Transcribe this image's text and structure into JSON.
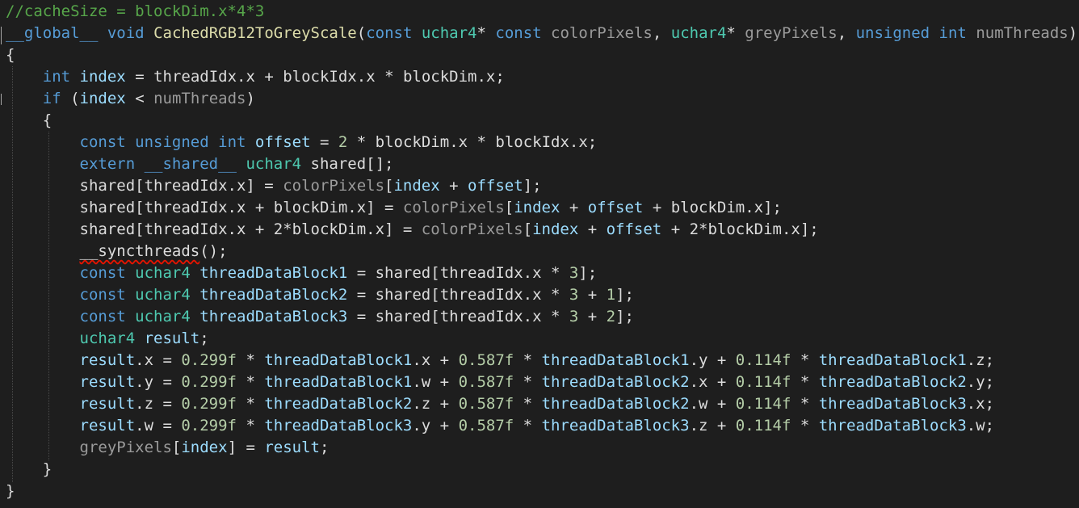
{
  "code": {
    "l1": {
      "t0": "//cacheSize = blockDim.x*4*3"
    },
    "l2": {
      "t0": "__global__",
      "t1": " ",
      "t2": "void",
      "t3": " ",
      "t4": "CachedRGB12ToGreyScale",
      "t5": "(",
      "t6": "const",
      "t7": " ",
      "t8": "uchar4",
      "t9": "* ",
      "t10": "const",
      "t11": " ",
      "t12": "colorPixels",
      "t13": ", ",
      "t14": "uchar4",
      "t15": "* ",
      "t16": "greyPixels",
      "t17": ", ",
      "t18": "unsigned",
      "t19": " ",
      "t20": "int",
      "t21": " ",
      "t22": "numThreads",
      "t23": ")"
    },
    "l3": {
      "t0": "{"
    },
    "l4": {
      "t0": "    ",
      "t1": "int",
      "t2": " ",
      "t3": "index",
      "t4": " = ",
      "t5": "threadIdx",
      "t6": ".x + ",
      "t7": "blockIdx",
      "t8": ".x * ",
      "t9": "blockDim",
      "t10": ".x;"
    },
    "l5": {
      "t0": "    ",
      "t1": "if",
      "t2": " (",
      "t3": "index",
      "t4": " < ",
      "t5": "numThreads",
      "t6": ")"
    },
    "l6": {
      "t0": "    {"
    },
    "l7": {
      "t0": "        ",
      "t1": "const",
      "t2": " ",
      "t3": "unsigned",
      "t4": " ",
      "t5": "int",
      "t6": " ",
      "t7": "offset",
      "t8": " = ",
      "t9": "2",
      "t10": " * ",
      "t11": "blockDim",
      "t12": ".x * ",
      "t13": "blockIdx",
      "t14": ".x;"
    },
    "l8": {
      "t0": "        ",
      "t1": "extern",
      "t2": " ",
      "t3": "__shared__",
      "t4": " ",
      "t5": "uchar4",
      "t6": " shared[];"
    },
    "l9": {
      "t0": "        shared[",
      "t1": "threadIdx",
      "t2": ".x] = ",
      "t3": "colorPixels",
      "t4": "[",
      "t5": "index",
      "t6": " + ",
      "t7": "offset",
      "t8": "];"
    },
    "l10": {
      "t0": "        shared[",
      "t1": "threadIdx",
      "t2": ".x + ",
      "t3": "blockDim",
      "t4": ".x] = ",
      "t5": "colorPixels",
      "t6": "[",
      "t7": "index",
      "t8": " + ",
      "t9": "offset",
      "t10": " + ",
      "t11": "blockDim",
      "t12": ".x];"
    },
    "l11": {
      "t0": "        shared[",
      "t1": "threadIdx",
      "t2": ".x + 2*",
      "t3": "blockDim",
      "t4": ".x] = ",
      "t5": "colorPixels",
      "t6": "[",
      "t7": "index",
      "t8": " + ",
      "t9": "offset",
      "t10": " + 2*",
      "t11": "blockDim",
      "t12": ".x];"
    },
    "l12": {
      "t0": "        ",
      "t1": "__syncthreads",
      "t2": "();"
    },
    "l13": {
      "t0": "        ",
      "t1": "const",
      "t2": " ",
      "t3": "uchar4",
      "t4": " ",
      "t5": "threadDataBlock1",
      "t6": " = shared[",
      "t7": "threadIdx",
      "t8": ".x * ",
      "t9": "3",
      "t10": "];"
    },
    "l14": {
      "t0": "        ",
      "t1": "const",
      "t2": " ",
      "t3": "uchar4",
      "t4": " ",
      "t5": "threadDataBlock2",
      "t6": " = shared[",
      "t7": "threadIdx",
      "t8": ".x * ",
      "t9": "3",
      "t10": " + ",
      "t11": "1",
      "t12": "];"
    },
    "l15": {
      "t0": "        ",
      "t1": "const",
      "t2": " ",
      "t3": "uchar4",
      "t4": " ",
      "t5": "threadDataBlock3",
      "t6": " = shared[",
      "t7": "threadIdx",
      "t8": ".x * ",
      "t9": "3",
      "t10": " + ",
      "t11": "2",
      "t12": "];"
    },
    "l16": {
      "t0": "        ",
      "t1": "uchar4",
      "t2": " ",
      "t3": "result",
      "t4": ";"
    },
    "l17": {
      "t0": "        ",
      "t1": "result",
      "t2": ".x = ",
      "t3": "0.299f",
      "t4": " * ",
      "t5": "threadDataBlock1",
      "t6": ".x + ",
      "t7": "0.587f",
      "t8": " * ",
      "t9": "threadDataBlock1",
      "t10": ".y + ",
      "t11": "0.114f",
      "t12": " * ",
      "t13": "threadDataBlock1",
      "t14": ".z;"
    },
    "l18": {
      "t0": "        ",
      "t1": "result",
      "t2": ".y = ",
      "t3": "0.299f",
      "t4": " * ",
      "t5": "threadDataBlock1",
      "t6": ".w + ",
      "t7": "0.587f",
      "t8": " * ",
      "t9": "threadDataBlock2",
      "t10": ".x + ",
      "t11": "0.114f",
      "t12": " * ",
      "t13": "threadDataBlock2",
      "t14": ".y;"
    },
    "l19": {
      "t0": "        ",
      "t1": "result",
      "t2": ".z = ",
      "t3": "0.299f",
      "t4": " * ",
      "t5": "threadDataBlock2",
      "t6": ".z + ",
      "t7": "0.587f",
      "t8": " * ",
      "t9": "threadDataBlock2",
      "t10": ".w + ",
      "t11": "0.114f",
      "t12": " * ",
      "t13": "threadDataBlock3",
      "t14": ".x;"
    },
    "l20": {
      "t0": "        ",
      "t1": "result",
      "t2": ".w = ",
      "t3": "0.299f",
      "t4": " * ",
      "t5": "threadDataBlock3",
      "t6": ".y + ",
      "t7": "0.587f",
      "t8": " * ",
      "t9": "threadDataBlock3",
      "t10": ".z + ",
      "t11": "0.114f",
      "t12": " * ",
      "t13": "threadDataBlock3",
      "t14": ".w;"
    },
    "l21": {
      "t0": "        ",
      "t1": "greyPixels",
      "t2": "[",
      "t3": "index",
      "t4": "] = ",
      "t5": "result",
      "t6": ";"
    },
    "l22": {
      "t0": "    }"
    },
    "l23": {
      "t0": "}"
    }
  },
  "colors": {
    "background": "#1e1e1e",
    "default_text": "#dcdcdc",
    "keyword": "#569cd6",
    "type": "#4ec9b0",
    "function": "#dcdcaa",
    "comment": "#57a64a",
    "variable": "#9cdcfe",
    "greyed": "#9b9b9b",
    "number": "#b5cea8",
    "error_squiggle": "#e51400"
  }
}
